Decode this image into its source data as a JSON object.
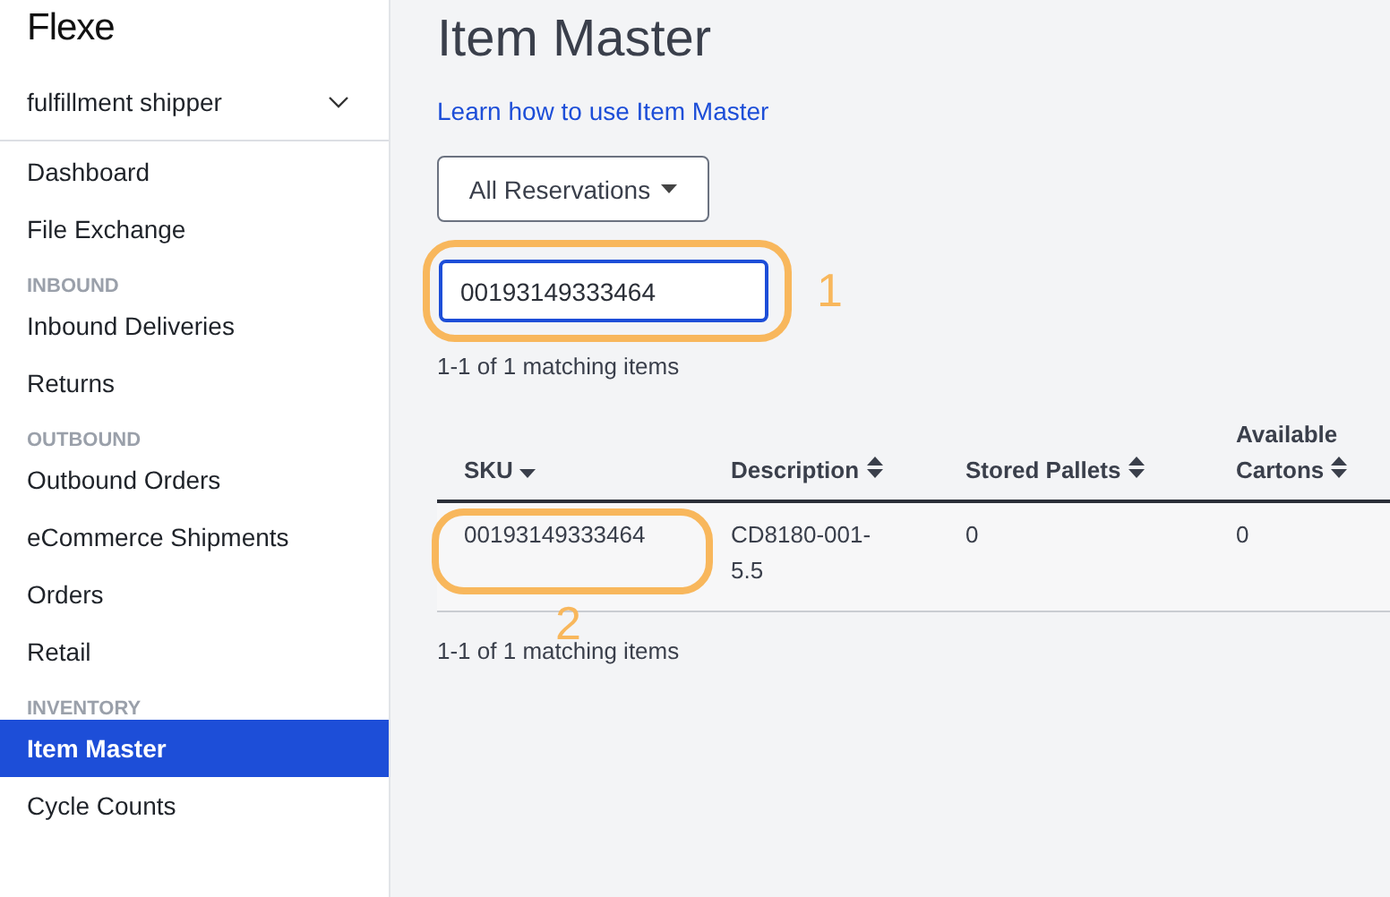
{
  "sidebar": {
    "logo": "Flexe",
    "account": {
      "label": "fulfillment shipper"
    },
    "sections": [
      {
        "items": [
          {
            "label": "Dashboard",
            "selected": false
          },
          {
            "label": "File Exchange",
            "selected": false
          }
        ]
      },
      {
        "header": "INBOUND",
        "items": [
          {
            "label": "Inbound Deliveries",
            "selected": false
          },
          {
            "label": "Returns",
            "selected": false
          }
        ]
      },
      {
        "header": "OUTBOUND",
        "items": [
          {
            "label": "Outbound Orders",
            "selected": false
          },
          {
            "label": "eCommerce Shipments",
            "selected": false
          },
          {
            "label": "Orders",
            "selected": false
          },
          {
            "label": "Retail",
            "selected": false
          }
        ]
      },
      {
        "header": "INVENTORY",
        "items": [
          {
            "label": "Item Master",
            "selected": true
          },
          {
            "label": "Cycle Counts",
            "selected": false
          }
        ]
      }
    ]
  },
  "main": {
    "title": "Item Master",
    "help_link": "Learn how to use Item Master",
    "filter": {
      "label": "All Reservations"
    },
    "search": {
      "value": "00193149333464"
    },
    "count_top": "1-1 of 1 matching items",
    "table": {
      "columns": [
        {
          "label": "SKU",
          "sorted": true
        },
        {
          "label": "Description",
          "sorted": false
        },
        {
          "label": "Stored Pallets",
          "sorted": false
        },
        {
          "label": "Available Cartons",
          "sorted": false
        }
      ],
      "rows": [
        [
          "00193149333464",
          "CD8180-001-5.5",
          "0",
          "0"
        ]
      ]
    },
    "count_bottom": "1-1 of 1 matching items"
  },
  "annotations": [
    {
      "number": "1"
    },
    {
      "number": "2"
    }
  ]
}
